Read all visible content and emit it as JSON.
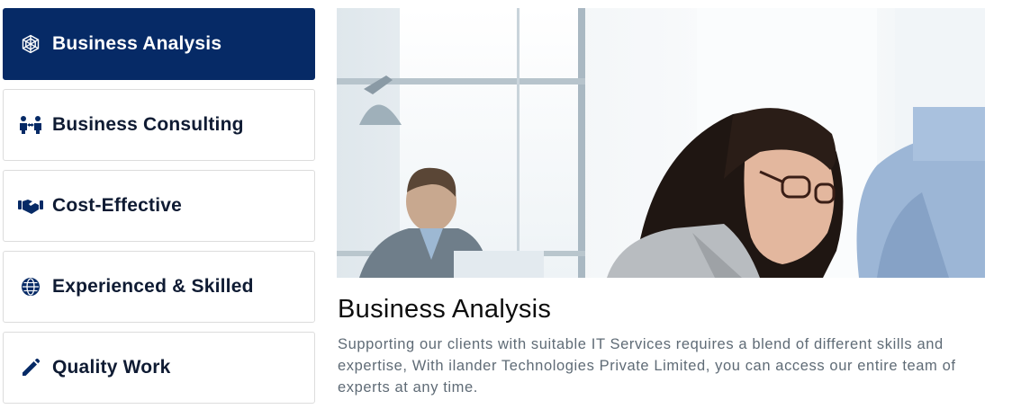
{
  "tabs": [
    {
      "label": "Business Analysis",
      "icon": "analysis-icon",
      "active": true
    },
    {
      "label": "Business Consulting",
      "icon": "consulting-icon",
      "active": false
    },
    {
      "label": "Cost-Effective",
      "icon": "handshake-icon",
      "active": false
    },
    {
      "label": "Experienced & Skilled",
      "icon": "globe-icon",
      "active": false
    },
    {
      "label": "Quality Work",
      "icon": "pencil-icon",
      "active": false
    }
  ],
  "content": {
    "title": "Business Analysis",
    "description": "Supporting our clients with suitable IT Services requires a blend of different skills and expertise, With ilander Technologies Private Limited, you can access our entire team of experts at any time."
  },
  "colors": {
    "active_tab_bg": "#062a66",
    "icon_color": "#062a66",
    "text_dark": "#0f1b33",
    "desc_gray": "#5f6b76"
  }
}
